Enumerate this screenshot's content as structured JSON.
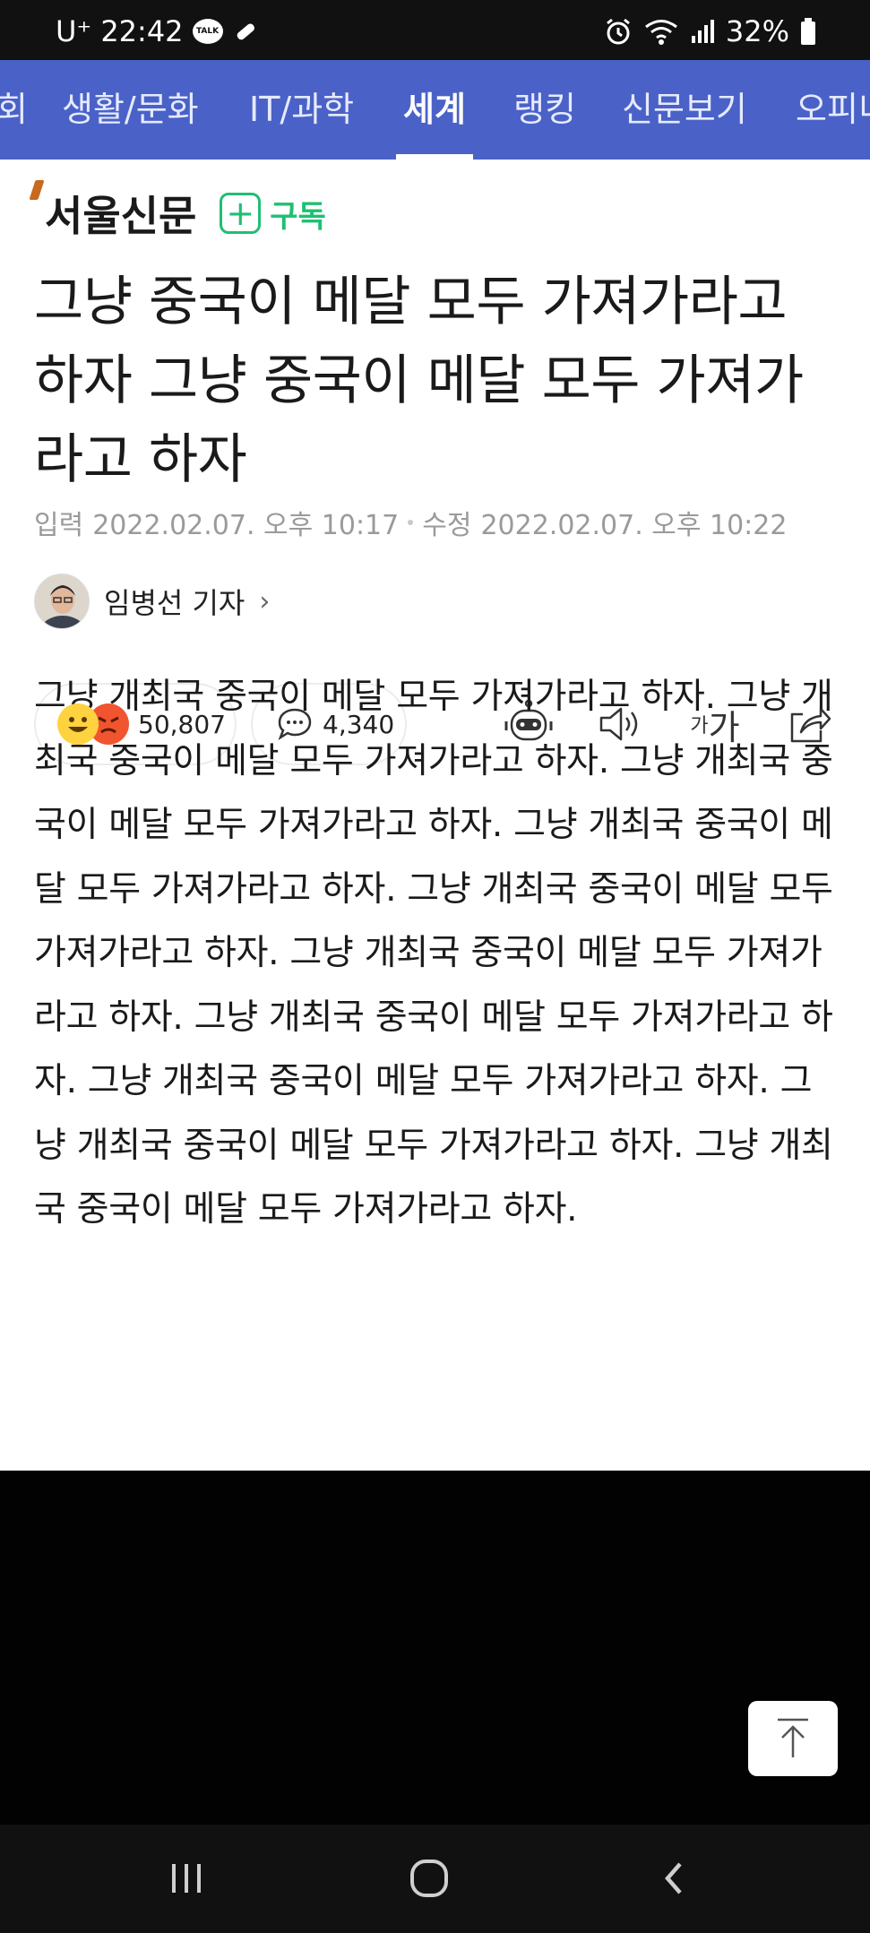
{
  "status_bar": {
    "carrier": "U⁺",
    "time": "22:42",
    "kakao_label": "TALK",
    "battery": "32%"
  },
  "nav": {
    "tabs": [
      {
        "label": "회"
      },
      {
        "label": "생활/문화"
      },
      {
        "label": "IT/과학"
      },
      {
        "label": "세계",
        "active": true
      },
      {
        "label": "랭킹"
      },
      {
        "label": "신문보기"
      },
      {
        "label": "오피니"
      }
    ]
  },
  "article": {
    "publisher": "서울신문",
    "subscribe_label": "구독",
    "headline": "그냥 중국이 메달 모두 가져가라고 하자 그냥 중국이 메달 모두 가져가라고 하자",
    "date_input_label": "입력",
    "date_input": "2022.02.07. 오후 10:17",
    "date_modified_label": "수정",
    "date_modified": "2022.02.07. 오후 10:22",
    "reporter": "임병선 기자",
    "reactions_count": "50,807",
    "comments_count": "4,340",
    "font_size_small": "가",
    "font_size_large": "가",
    "body": "그냥 개최국 중국이 메달 모두 가져가라고 하자. 그냥 개최국 중국이 메달 모두 가져가라고 하자. 그냥 개최국 중국이 메달 모두 가져가라고 하자. 그냥 개최국 중국이 메달 모두 가져가라고 하자. 그냥 개최국 중국이 메달 모두 가져가라고 하자. 그냥 개최국 중국이 메달 모두 가져가라고 하자. 그냥 개최국 중국이 메달 모두 가져가라고 하자. 그냥 개최국 중국이 메달 모두 가져가라고 하자. 그냥 개최국 중국이 메달 모두 가져가라고 하자. 그냥 개최국 중국이 메달 모두 가져가라고 하자."
  },
  "colors": {
    "nav_bg": "#4a62c7",
    "subscribe_green": "#1fbf73",
    "logo_accent": "#c8691f"
  },
  "icons": {
    "reaction_1": "smile-emoji-icon",
    "reaction_2": "angry-emoji-icon",
    "comments": "speech-bubble-icon",
    "summary_bot": "robot-icon",
    "tts": "speaker-icon",
    "share": "share-icon",
    "scroll_top": "arrow-up-icon"
  }
}
